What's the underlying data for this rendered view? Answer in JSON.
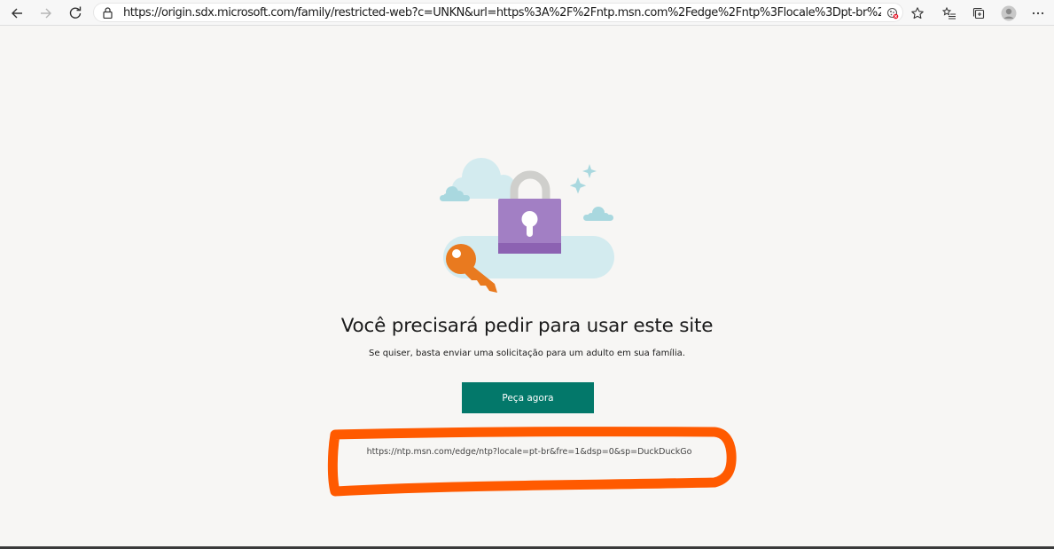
{
  "browser": {
    "address_bar": {
      "url": "https://origin.sdx.microsoft.com/family/restricted-web?c=UNKN&url=https%3A%2F%2Fntp.msn.com%2Fedge%2Fntp%3Flocale%3Dpt-br%26fre%3D1%26dsp..."
    },
    "icons": {
      "back": "back-arrow-icon",
      "forward": "forward-arrow-icon",
      "refresh": "refresh-icon",
      "lock": "lock-icon",
      "tracking": "tracking-prevention-icon",
      "favorite": "star-icon",
      "favorites": "favorites-list-icon",
      "collections": "collections-icon",
      "profile": "profile-avatar-icon",
      "menu": "more-options-icon"
    }
  },
  "page": {
    "title": "Você precisará pedir para usar este site",
    "subtitle": "Se quiser, basta enviar uma solicitação para um adulto em sua família.",
    "ask_button_label": "Peça agora",
    "blocked_url": "https://ntp.msn.com/edge/ntp?locale=pt-br&fre=1&dsp=0&sp=DuckDuckGo"
  },
  "colors": {
    "button": "#03786a",
    "annotation": "#ff5a00",
    "lock_body": "#a27fc4",
    "key": "#e97a1f",
    "cloud": "#d3ebef"
  }
}
